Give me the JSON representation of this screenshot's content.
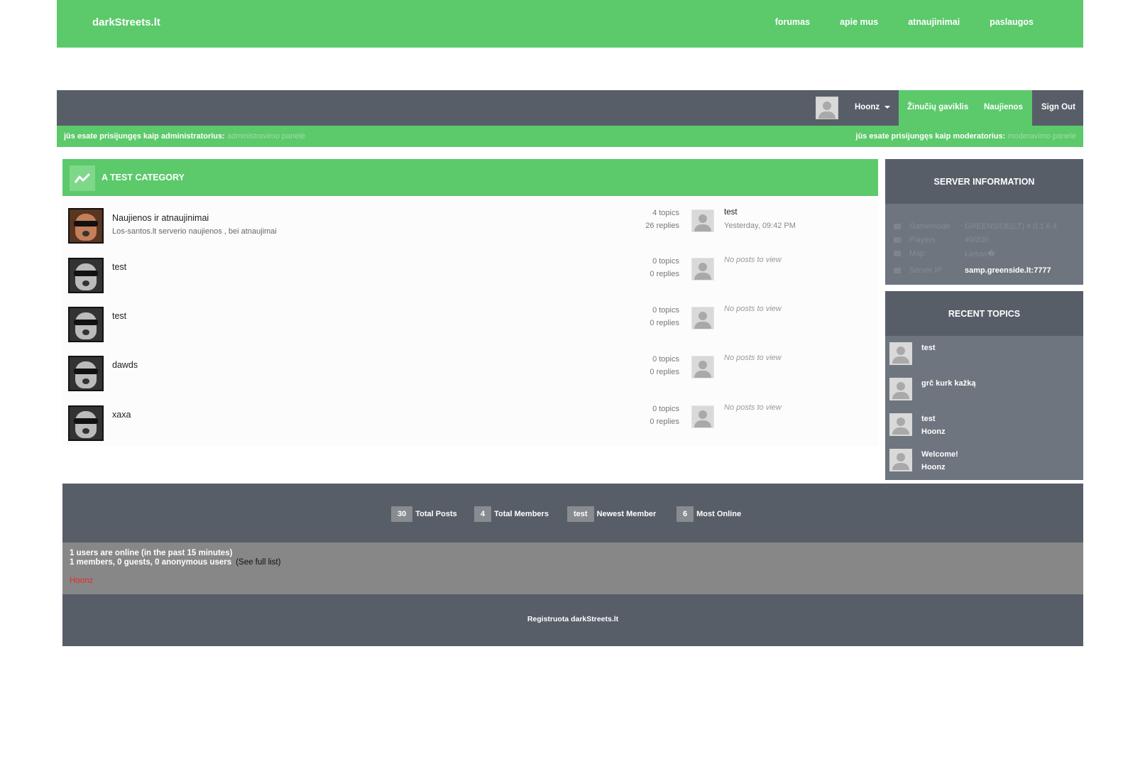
{
  "nav": {
    "brand": "darkStreets.lt",
    "links": [
      "forumas",
      "apie mus",
      "atnaujinimai",
      "paslaugos"
    ]
  },
  "userbar": {
    "username": "Hoonz",
    "messages": "Žinučių gaviklis",
    "news": "Naujienos",
    "signout": "Sign Out"
  },
  "roles": {
    "admin_text": "jūs esate prisijungęs kaip administratorius:",
    "admin_link": "administravimo panelė",
    "mod_text": "jūs esate prisijungęs kaip moderatorius:",
    "mod_link": "moderavimo panelė"
  },
  "category": {
    "title": "A TEST CATEGORY",
    "forums": [
      {
        "name": "Naujienos ir atnaujinimai",
        "desc": "Los-santos.lt serverio naujienos , bei atnaujimai",
        "topics": "4 topics",
        "replies": "26 replies",
        "last_title": "test",
        "last_time": "Yesterday, 09:42 PM"
      },
      {
        "name": "test",
        "desc": "",
        "topics": "0 topics",
        "replies": "0 replies",
        "last_title": "",
        "last_time": "",
        "no_posts": "No posts to view"
      },
      {
        "name": "test",
        "desc": "",
        "topics": "0 topics",
        "replies": "0 replies",
        "last_title": "",
        "last_time": "",
        "no_posts": "No posts to view"
      },
      {
        "name": "dawds",
        "desc": "",
        "topics": "0 topics",
        "replies": "0 replies",
        "last_title": "",
        "last_time": "",
        "no_posts": "No posts to view"
      },
      {
        "name": "xaxa",
        "desc": "",
        "topics": "0 topics",
        "replies": "0 replies",
        "last_title": "",
        "last_time": "",
        "no_posts": "No posts to view"
      }
    ]
  },
  "server": {
    "title": "SERVER INFORMATION",
    "rows": [
      {
        "label": "Gamemode",
        "value": "GREENSIDE(LT) # 0.1.6.4"
      },
      {
        "label": "Players",
        "value": "40/200"
      },
      {
        "label": "Map",
        "value": "Lietuvi�"
      },
      {
        "label": "Server IP",
        "value": "samp.greenside.lt:7777"
      }
    ]
  },
  "recent": {
    "title": "RECENT TOPICS",
    "items": [
      {
        "title": "test",
        "user": ""
      },
      {
        "title": "grč kurk kažką",
        "user": ""
      },
      {
        "title": "test",
        "user": "Hoonz"
      },
      {
        "title": "Welcome!",
        "user": "Hoonz"
      }
    ]
  },
  "stats": {
    "posts_num": "30",
    "posts_label": "Total Posts",
    "members_num": "4",
    "members_label": "Total Members",
    "newest_num": "test",
    "newest_label": "Newest Member",
    "online_num": "6",
    "online_label": "Most Online"
  },
  "online": {
    "line1": "1 users are online (in the past 15 minutes)",
    "line2": "1 members, 0 guests, 0 anonymous users",
    "full_list": "(See full list)",
    "user": "Hoonz"
  },
  "footer": {
    "text": "Registruota darkStreets.lt"
  }
}
